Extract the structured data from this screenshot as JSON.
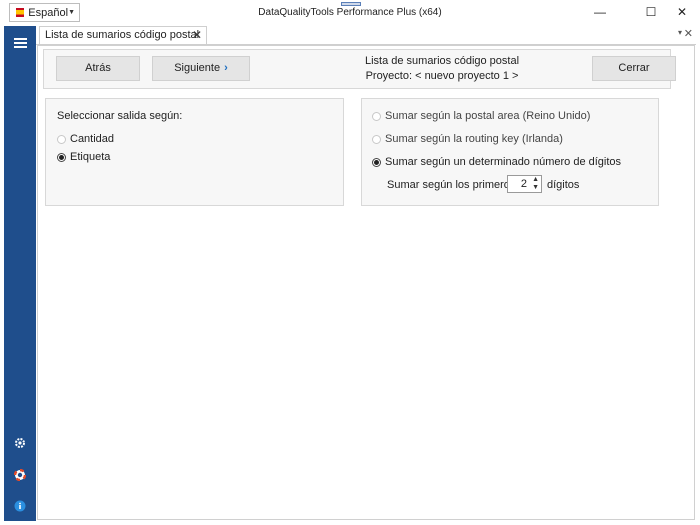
{
  "window": {
    "title": "DataQualityTools Performance Plus (x64)",
    "language": "Español",
    "minimize": "—",
    "maximize": "☐",
    "close": "✕"
  },
  "sidebar": {
    "menu_icon": "hamburger-menu-icon",
    "bottom_icons": [
      "gear-icon",
      "lifebuoy-icon",
      "info-icon"
    ]
  },
  "tab": {
    "label": "Lista de sumarios código postal",
    "close": "✕",
    "dropdown": "▾",
    "close_all": "✕"
  },
  "header": {
    "back_label": "Atrás",
    "next_label": "Siguiente",
    "close_label": "Cerrar",
    "title": "Lista de sumarios código postal",
    "project": "Proyecto: < nuevo proyecto 1 >"
  },
  "left_group": {
    "title": "Seleccionar salida según:",
    "options": [
      {
        "label": "Cantidad",
        "selected": false
      },
      {
        "label": "Etiqueta",
        "selected": true
      }
    ]
  },
  "right_group": {
    "options": [
      {
        "label": "Sumar según la postal area (Reino Unido)",
        "selected": false
      },
      {
        "label": "Sumar según la routing key (Irlanda)",
        "selected": false
      },
      {
        "label": "Sumar según un determinado número de dígitos",
        "selected": true
      }
    ],
    "digits_prefix": "Sumar según los primeros",
    "digits_value": "2",
    "digits_suffix": "dígitos"
  },
  "colors": {
    "sidebar": "#1f4e8c",
    "accent": "#1e6fc0"
  }
}
